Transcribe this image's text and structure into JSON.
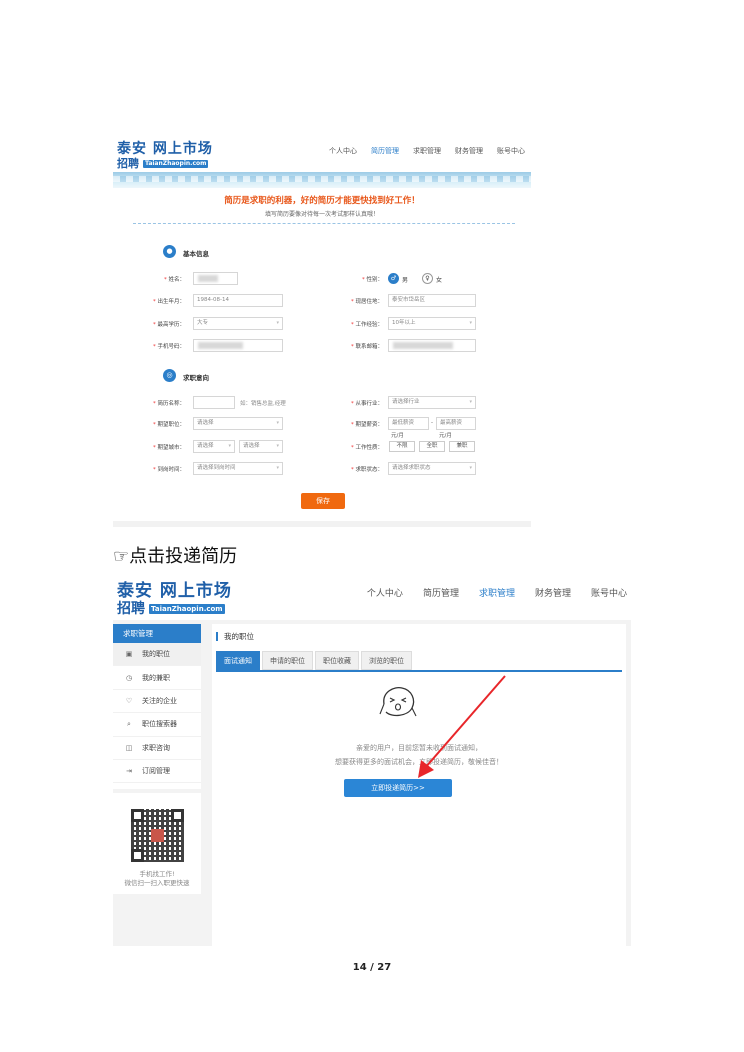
{
  "shot1": {
    "logo": {
      "line1": "泰安 网上市场",
      "line2": "招聘",
      "url": "TaianZhaopin.com"
    },
    "nav": [
      "个人中心",
      "简历管理",
      "求职管理",
      "财务管理",
      "账号中心"
    ],
    "nav_active_index": 1,
    "slogan": "简历是求职的利器，好的简历才能更快找到好工作！",
    "subtitle": "填写简历要像对待每一次考试那样认真哦！",
    "basic": {
      "title": "基本信息",
      "name_label": "姓名：",
      "gender_label": "性别：",
      "male": "男",
      "female": "女",
      "birth_label": "出生年月：",
      "birth_value": "1984-08-14",
      "residence_label": "现居住地：",
      "residence_value": "泰安市岱岳区",
      "edu_label": "最高学历：",
      "edu_value": "大专",
      "exp_label": "工作经验：",
      "exp_value": "10年以上",
      "phone_label": "手机号码：",
      "email_label": "联系邮箱："
    },
    "intent": {
      "title": "求职意向",
      "resume_name_label": "简历名称：",
      "resume_name_hint": "如：销售总监,经理",
      "industry_label": "从事行业：",
      "industry_placeholder": "请选择行业",
      "position_label": "期望职位：",
      "position_placeholder": "请选择",
      "salary_label": "期望薪资：",
      "salary_min": "最低薪资",
      "salary_max": "最高薪资",
      "salary_unit": "元/月",
      "city_label": "期望城市：",
      "city_placeholder_1": "请选择",
      "city_placeholder_2": "请选择",
      "worktype_label": "工作性质：",
      "worktype_options": [
        "不限",
        "全职",
        "兼职"
      ],
      "arrival_label": "到岗时间：",
      "arrival_placeholder": "请选择到岗时间",
      "status_label": "求职状态：",
      "status_placeholder": "请选择求职状态"
    },
    "save_label": "保存"
  },
  "caption": "☞点击投递简历",
  "shot2": {
    "logo": {
      "line1": "泰安 网上市场",
      "line2": "招聘",
      "url": "TaianZhaopin.com"
    },
    "nav": [
      "个人中心",
      "简历管理",
      "求职管理",
      "财务管理",
      "账号中心"
    ],
    "nav_active_index": 2,
    "sidebar": {
      "head": "求职管理",
      "items": [
        {
          "label": "我的职位",
          "icon": "briefcase-icon",
          "glyph": "▣"
        },
        {
          "label": "我的兼职",
          "icon": "clock-icon",
          "glyph": "◷"
        },
        {
          "label": "关注的企业",
          "icon": "heart-icon",
          "glyph": "♡"
        },
        {
          "label": "职位搜索器",
          "icon": "search-icon",
          "glyph": "⌕"
        },
        {
          "label": "求职咨询",
          "icon": "chat-icon",
          "glyph": "◫"
        },
        {
          "label": "订阅管理",
          "icon": "subscribe-icon",
          "glyph": "⇥"
        }
      ],
      "qr_text_1": "手机找工作!",
      "qr_text_2": "微信扫一扫入职更快速"
    },
    "main": {
      "title": "我的职位",
      "tabs": [
        "面试通知",
        "申请的职位",
        "职位收藏",
        "浏览的职位"
      ],
      "message_1": "亲爱的用户，目前您暂未收到面试通知，",
      "message_2": "想要获得更多的面试机会，立即投递简历，敬候佳音！",
      "deliver_button": "立即投递简历>>"
    },
    "arrow_color": "#e8262a"
  },
  "page_number": "14 / 27"
}
